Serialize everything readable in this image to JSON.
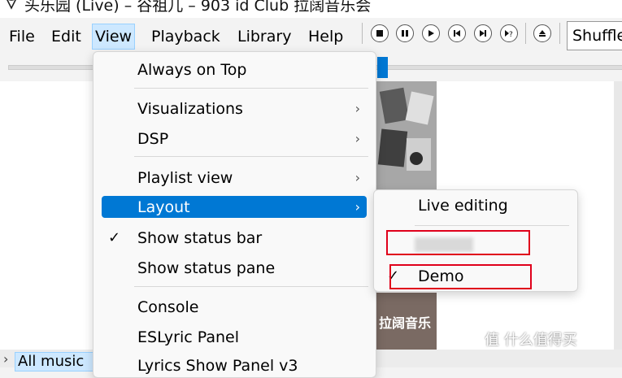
{
  "window": {
    "title": "头乐园 (Live) – 谷祖儿 – 903 id Club 拉阔音乐会"
  },
  "menubar": {
    "items": [
      "File",
      "Edit",
      "View",
      "Playback",
      "Library",
      "Help"
    ]
  },
  "toolbar": {
    "buttons": [
      "stop-icon",
      "pause-icon",
      "play-icon",
      "previous-icon",
      "next-icon",
      "random-icon",
      "eject-icon"
    ],
    "order_box": "Shuffle"
  },
  "view_menu": {
    "items": [
      {
        "label": "Always on Top"
      },
      {
        "label": "Visualizations",
        "submenu": true
      },
      {
        "label": "DSP",
        "submenu": true
      },
      {
        "label": "Playlist view",
        "submenu": true
      },
      {
        "label": "Layout",
        "submenu": true,
        "highlighted": true
      },
      {
        "label": "Show status bar",
        "checked": true
      },
      {
        "label": "Show status pane"
      },
      {
        "label": "Console"
      },
      {
        "label": "ESLyric Panel"
      },
      {
        "label": "Lyrics Show Panel v3"
      }
    ]
  },
  "layout_submenu": {
    "items": [
      {
        "label": "Live editing"
      },
      {
        "label": "",
        "redacted": true
      },
      {
        "label": "Demo",
        "checked": true
      }
    ]
  },
  "library": {
    "tree_item": "All music"
  },
  "glyphs": {
    "submenu_arrow": "›",
    "check": "✓",
    "expand": "›"
  },
  "watermark": "值 什么值得买",
  "album_art": {
    "caption": "拉阔音乐"
  },
  "colors": {
    "accent": "#0078d4",
    "highlight_box": "#e0001b"
  }
}
